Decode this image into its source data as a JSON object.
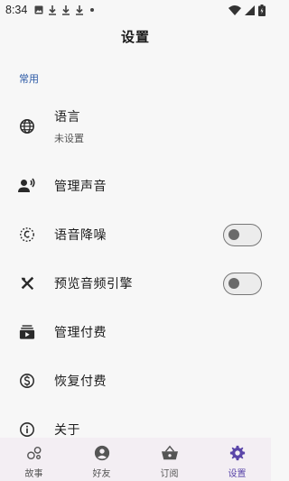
{
  "status": {
    "time": "8:34"
  },
  "header": {
    "title": "设置"
  },
  "section": {
    "title": "常用"
  },
  "settings": [
    {
      "id": "language",
      "label": "语言",
      "sub": "未设置",
      "icon": "globe-icon"
    },
    {
      "id": "voice",
      "label": "管理声音",
      "icon": "speaking-person-icon"
    },
    {
      "id": "noise",
      "label": "语音降噪",
      "icon": "noise-reduction-icon",
      "toggle": false
    },
    {
      "id": "engine",
      "label": "预览音频引擎",
      "icon": "tools-icon",
      "toggle": false
    },
    {
      "id": "payment",
      "label": "管理付费",
      "icon": "subscriptions-icon"
    },
    {
      "id": "restore",
      "label": "恢复付费",
      "icon": "dollar-circle-icon"
    },
    {
      "id": "about",
      "label": "关于",
      "icon": "info-icon"
    }
  ],
  "nav": [
    {
      "label": "故事",
      "icon": "bubbles-icon",
      "active": false
    },
    {
      "label": "好友",
      "icon": "account-icon",
      "active": false
    },
    {
      "label": "订阅",
      "icon": "basket-icon",
      "active": false
    },
    {
      "label": "设置",
      "icon": "gear-icon",
      "active": true
    }
  ],
  "colors": {
    "accent": "#5a45a8",
    "section": "#2c5aa6",
    "nav_background": "#f3eef3"
  }
}
